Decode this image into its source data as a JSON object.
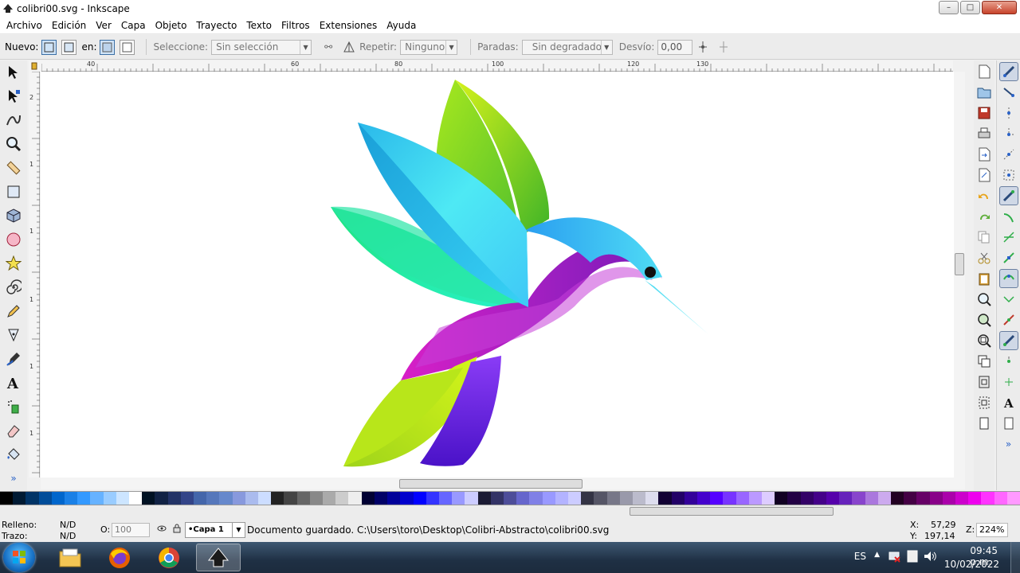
{
  "window": {
    "title": "colibri00.svg - Inkscape",
    "min_label": "–",
    "max_label": "□",
    "close_label": "✕"
  },
  "menu": {
    "items": [
      "Archivo",
      "Edición",
      "Ver",
      "Capa",
      "Objeto",
      "Trayecto",
      "Texto",
      "Filtros",
      "Extensiones",
      "Ayuda"
    ]
  },
  "controls": {
    "nuevo_label": "Nuevo:",
    "en_label": "en:",
    "seleccione_label": "Seleccione:",
    "seleccione_value": "Sin selección",
    "repetir_label": "Repetir:",
    "repetir_value": "Ninguno",
    "paradas_label": "Paradas:",
    "paradas_value": "Sin degradado",
    "desvio_label": "Desvío:",
    "desvio_value": "0,00"
  },
  "ruler": {
    "h_labels": [
      "40",
      "60",
      "80",
      "100",
      "120",
      "130"
    ],
    "v_labels": [
      "2",
      "1",
      "1",
      "1",
      "1",
      "1"
    ]
  },
  "palette": {
    "colors": [
      "#000000",
      "#001a33",
      "#003366",
      "#004c99",
      "#0066cc",
      "#1a80e6",
      "#3399ff",
      "#66b2ff",
      "#99ccff",
      "#cce5ff",
      "#ffffff",
      "#001122",
      "#112244",
      "#223366",
      "#334488",
      "#4466aa",
      "#5577bb",
      "#6688cc",
      "#8899dd",
      "#aabbee",
      "#ccddff",
      "#222222",
      "#444444",
      "#666666",
      "#888888",
      "#aaaaaa",
      "#cccccc",
      "#eeeeee",
      "#000033",
      "#000066",
      "#000099",
      "#0000cc",
      "#0000ff",
      "#3333ff",
      "#6666ff",
      "#9999ff",
      "#ccccff",
      "#1a1a33",
      "#333366",
      "#4d4d99",
      "#6666cc",
      "#8080e6",
      "#9999ff",
      "#b3b3ff",
      "#ccccff",
      "#333344",
      "#555566",
      "#777788",
      "#9999aa",
      "#bbbbcc",
      "#ddddee",
      "#110033",
      "#220066",
      "#330099",
      "#4400cc",
      "#5500ff",
      "#7733ff",
      "#9966ff",
      "#bb99ff",
      "#ddccff",
      "#110022",
      "#220044",
      "#330066",
      "#440088",
      "#5500aa",
      "#6622bb",
      "#8844cc",
      "#aa77dd",
      "#ccaaee",
      "#220022",
      "#440044",
      "#660066",
      "#880088",
      "#aa00aa",
      "#cc00cc",
      "#ee00ee",
      "#ff33ff",
      "#ff66ff",
      "#ff99ff"
    ]
  },
  "status": {
    "relleno_label": "Relleno:",
    "relleno_value": "N/D",
    "trazo_label": "Trazo:",
    "trazo_value": "N/D",
    "opacity_label": "O:",
    "opacity_value": "100",
    "layer_value": "•Capa 1",
    "message": "Documento guardado. C:\\Users\\toro\\Desktop\\Colibri-Abstracto\\colibri00.svg",
    "x_label": "X:",
    "x_value": "57,29",
    "y_label": "Y:",
    "y_value": "197,14",
    "zoom_label": "Z:",
    "zoom_value": "224%"
  },
  "taskbar": {
    "lang": "ES",
    "time": "09:45 p.m.",
    "date": "10/02/2022"
  },
  "colors": {
    "bird_purple": "#a31fc2",
    "bird_cyan": "#29c6f0",
    "bird_lime": "#c2ea1a",
    "bird_violet": "#6a1ed8",
    "bird_green": "#1fd69a"
  }
}
